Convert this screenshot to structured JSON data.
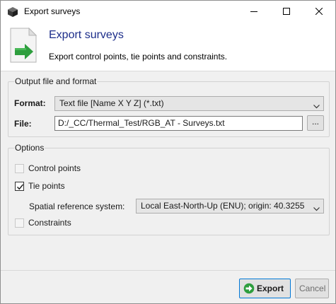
{
  "window": {
    "title": "Export surveys"
  },
  "header": {
    "title": "Export surveys",
    "subtitle": "Export control points, tie points and constraints."
  },
  "output_group": {
    "title": "Output file and format",
    "format_label": "Format:",
    "format_value": "Text file [Name X Y Z] (*.txt)",
    "file_label": "File:",
    "file_value": "D:/_CC/Thermal_Test/RGB_AT - Surveys.txt",
    "browse_label": "..."
  },
  "options_group": {
    "title": "Options",
    "control_points": {
      "label": "Control points",
      "checked": false
    },
    "tie_points": {
      "label": "Tie points",
      "checked": true
    },
    "srs_label": "Spatial reference system:",
    "srs_value": "Local East-North-Up (ENU); origin: 40.3255",
    "constraints": {
      "label": "Constraints",
      "checked": false
    }
  },
  "footer": {
    "export_label": "Export",
    "cancel_label": "Cancel"
  },
  "colors": {
    "title_blue": "#1c2d8a",
    "export_icon_green": "#2e9e3e",
    "focus_blue": "#0078d7"
  }
}
